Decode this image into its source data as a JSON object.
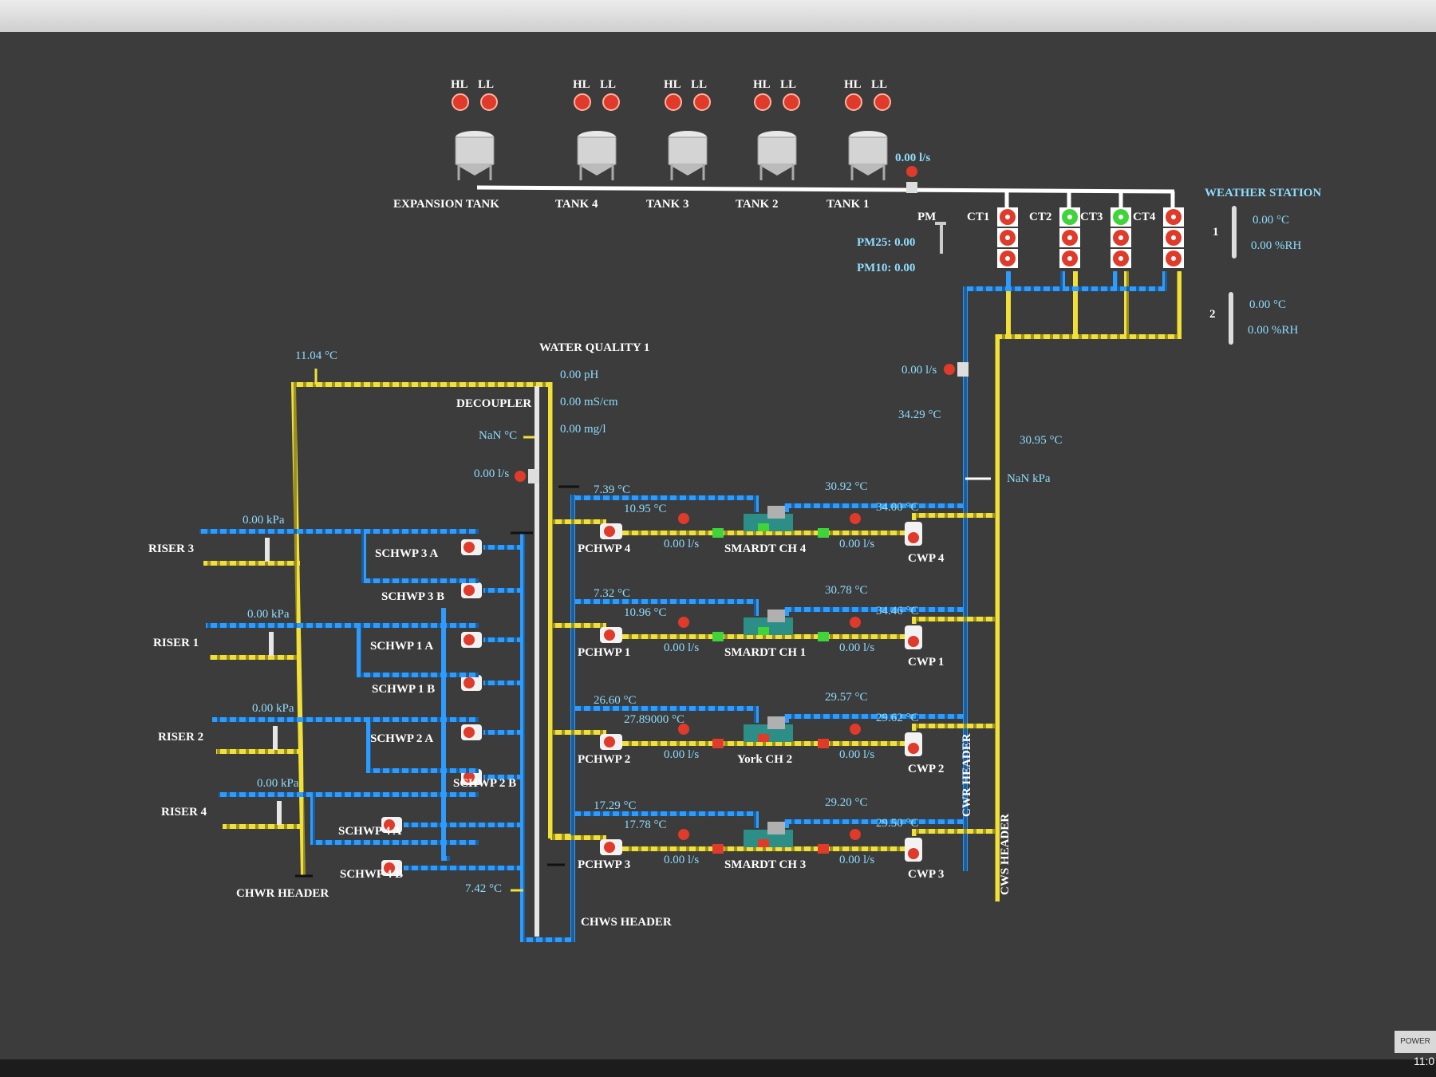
{
  "tanks": [
    {
      "name": "EXPANSION TANK",
      "hl": "HL",
      "ll": "LL"
    },
    {
      "name": "TANK 4",
      "hl": "HL",
      "ll": "LL"
    },
    {
      "name": "TANK 3",
      "hl": "HL",
      "ll": "LL"
    },
    {
      "name": "TANK 2",
      "hl": "HL",
      "ll": "LL"
    },
    {
      "name": "TANK 1",
      "hl": "HL",
      "ll": "LL"
    }
  ],
  "makeup_flow": "0.00 l/s",
  "pm": {
    "label": "PM",
    "pm25": "PM25: 0.00",
    "pm10": "PM10: 0.00"
  },
  "cooling_towers": [
    {
      "label": "CT1",
      "status": "red"
    },
    {
      "label": "CT2",
      "status": "green"
    },
    {
      "label": "CT3",
      "status": "green"
    },
    {
      "label": "CT4",
      "status": "red"
    }
  ],
  "weather": {
    "title": "WEATHER STATION",
    "sensors": [
      {
        "id": "1",
        "temp": "0.00 °C",
        "rh": "0.00 %RH"
      },
      {
        "id": "2",
        "temp": "0.00 °C",
        "rh": "0.00 %RH"
      }
    ]
  },
  "water_quality": {
    "title": "WATER QUALITY 1",
    "ph": "0.00 pH",
    "cond": "0.00 mS/cm",
    "mgl": "0.00 mg/l"
  },
  "decoupler": {
    "label": "DECOUPLER",
    "temp": "NaN °C",
    "flow": "0.00 l/s"
  },
  "chwr_temp": "11.04 °C",
  "chws_temp": "7.42 °C",
  "cwr": {
    "flow": "0.00 l/s",
    "temp": "34.29 °C",
    "label": "CWR HEADER"
  },
  "cws": {
    "temp": "30.95 °C",
    "press": "NaN kPa",
    "label": "CWS HEADER"
  },
  "headers": {
    "chwr": "CHWR HEADER",
    "chws": "CHWS HEADER"
  },
  "risers": [
    {
      "name": "RISER 3",
      "press": "0.00 kPa"
    },
    {
      "name": "RISER 1",
      "press": "0.00 kPa"
    },
    {
      "name": "RISER 2",
      "press": "0.00 kPa"
    },
    {
      "name": "RISER 4",
      "press": "0.00 kPa"
    }
  ],
  "schwp": [
    "SCHWP 3 A",
    "SCHWP 3 B",
    "SCHWP 1 A",
    "SCHWP 1 B",
    "SCHWP 2 A",
    "SCHWP 2 B",
    "SCHWP 4 A",
    "SCHWP 4 B"
  ],
  "chillers": [
    {
      "name": "SMARDT CH 4",
      "pchwp": "PCHWP 4",
      "cwp": "CWP 4",
      "chw_ret": "7.39 °C",
      "chw_sup": "10.95 °C",
      "chw_flow": "0.00 l/s",
      "cw_ret": "30.92 °C",
      "cw_sup": "34.00 °C",
      "cw_flow": "0.00 l/s"
    },
    {
      "name": "SMARDT CH 1",
      "pchwp": "PCHWP 1",
      "cwp": "CWP 1",
      "chw_ret": "7.32 °C",
      "chw_sup": "10.96 °C",
      "chw_flow": "0.00 l/s",
      "cw_ret": "30.78 °C",
      "cw_sup": "34.46 °C",
      "cw_flow": "0.00 l/s"
    },
    {
      "name": "York CH 2",
      "pchwp": "PCHWP 2",
      "cwp": "CWP 2",
      "chw_ret": "26.60 °C",
      "chw_sup": "27.89000 °C",
      "chw_flow": "0.00 l/s",
      "cw_ret": "29.57 °C",
      "cw_sup": "29.62 °C",
      "cw_flow": "0.00 l/s"
    },
    {
      "name": "SMARDT CH 3",
      "pchwp": "PCHWP 3",
      "cwp": "CWP 3",
      "chw_ret": "17.29 °C",
      "chw_sup": "17.78 °C",
      "chw_flow": "0.00 l/s",
      "cw_ret": "29.20 °C",
      "cw_sup": "29.50 °C",
      "cw_flow": "0.00 l/s"
    }
  ],
  "taskbar": {
    "power": "POWER",
    "clock": "11:0"
  },
  "colors": {
    "background": "#3b3c3b",
    "chw_pipe": "#2e9bff",
    "cw_pipe": "#f2e03a",
    "alarm": "#e03a2a",
    "running": "#3fd43a",
    "value_text": "#8fdcff"
  }
}
